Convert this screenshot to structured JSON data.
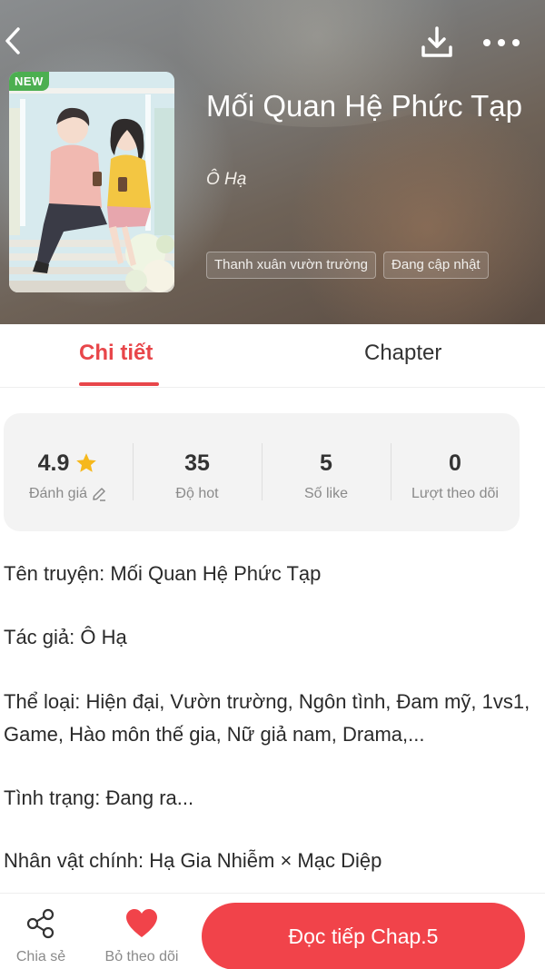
{
  "header": {
    "badge": "NEW",
    "title": "Mối Quan Hệ Phức Tạp",
    "author": "Ô Hạ",
    "tags": [
      "Thanh xuân vườn trường",
      "Đang cập nhật"
    ]
  },
  "tabs": [
    {
      "label": "Chi tiết",
      "active": true
    },
    {
      "label": "Chapter",
      "active": false
    }
  ],
  "stats": [
    {
      "value": "4.9",
      "label": "Đánh giá"
    },
    {
      "value": "35",
      "label": "Độ hot"
    },
    {
      "value": "5",
      "label": "Số like"
    },
    {
      "value": "0",
      "label": "Lượt theo dõi"
    }
  ],
  "info": {
    "name": "Tên truyện: Mối Quan Hệ Phức Tạp",
    "author": "Tác giả: Ô Hạ",
    "genre": "Thể loại: Hiện đại, Vườn trường, Ngôn tình, Đam mỹ, 1vs1, Game, Hào môn thế gia, Nữ giả nam, Drama,...",
    "status": "Tình trạng: Đang ra...",
    "characters": "Nhân vật chính: Hạ Gia Nhiễm × Mạc Diệp"
  },
  "bottom": {
    "share": "Chia sẻ",
    "unfollow": "Bỏ theo dõi",
    "read": "Đọc tiếp Chap.5"
  },
  "colors": {
    "accent": "#e8464a",
    "button": "#f1434a",
    "star": "#f6b81c",
    "badge": "#4caf50"
  }
}
